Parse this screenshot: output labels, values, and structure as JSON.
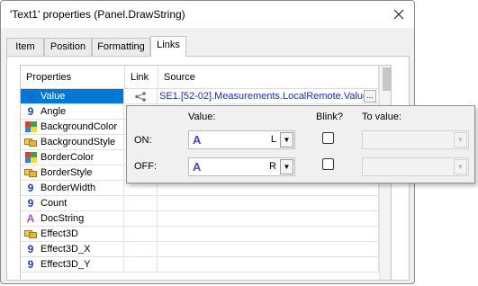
{
  "window": {
    "title": "'Text1' properties (Panel.DrawString)"
  },
  "tabs": [
    {
      "label": "Item"
    },
    {
      "label": "Position"
    },
    {
      "label": "Formatting"
    },
    {
      "label": "Links",
      "active": true
    }
  ],
  "grid": {
    "headers": {
      "properties": "Properties",
      "link": "Link",
      "source": "Source"
    },
    "rows": [
      {
        "name": "Value",
        "icon": "value-type-icon",
        "selected": true,
        "link_icon": "link-icon",
        "source": "SE1.[52-02].Measurements.LocalRemote.Value",
        "source_button": "..."
      },
      {
        "name": "Angle",
        "icon": "numeric-icon"
      },
      {
        "name": "BackgroundColor",
        "icon": "color-icon"
      },
      {
        "name": "BackgroundStyle",
        "icon": "style-icon"
      },
      {
        "name": "BorderColor",
        "icon": "color-icon"
      },
      {
        "name": "BorderStyle",
        "icon": "style-icon"
      },
      {
        "name": "BorderWidth",
        "icon": "numeric-icon"
      },
      {
        "name": "Count",
        "icon": "numeric-icon"
      },
      {
        "name": "DocString",
        "icon": "text-icon"
      },
      {
        "name": "Effect3D",
        "icon": "style-icon"
      },
      {
        "name": "Effect3D_X",
        "icon": "numeric-icon"
      },
      {
        "name": "Effect3D_Y",
        "icon": "numeric-icon"
      }
    ]
  },
  "popup": {
    "headers": {
      "value": "Value:",
      "blink": "Blink?",
      "to_value": "To value:"
    },
    "on": {
      "label": "ON:",
      "value": "L",
      "blink": false,
      "to_value": ""
    },
    "off": {
      "label": "OFF:",
      "value": "R",
      "blink": false,
      "to_value": ""
    },
    "glyph": "A"
  },
  "colors": {
    "selection": "#0078d7",
    "source_text": "#1a2bc5",
    "text_glyph": "#5a3cc8"
  }
}
